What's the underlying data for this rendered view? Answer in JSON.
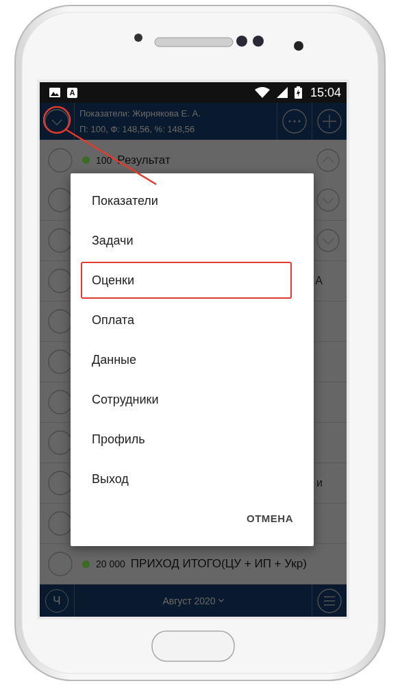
{
  "status_bar": {
    "badge": "A",
    "time": "15:04"
  },
  "header": {
    "title": "Показатели: Жирнякова Е. А.",
    "subtitle": "П: 100, Ф: 148,56, %: 148,56",
    "menu_button": {
      "highlighted": true
    }
  },
  "rows": [
    {
      "value": "100",
      "label": "Результат",
      "color": "#3b6b24",
      "expand_button": {
        "expanded": true
      }
    },
    {
      "expand_button": {
        "expanded": false
      }
    },
    {
      "expand_button": {
        "expanded": false
      }
    },
    {
      "tail": "А"
    },
    {},
    {},
    {},
    {},
    {
      "tail": "и"
    },
    {},
    {
      "value": "20 000",
      "label": "ПРИХОД ИТОГО(ЦУ + ИП + Укр)",
      "color": "#3b6b24"
    }
  ],
  "bottom_bar": {
    "left_button": "Ч",
    "period": "Август 2020"
  },
  "dialog": {
    "items": [
      {
        "label": "Показатели",
        "selected": false
      },
      {
        "label": "Задачи",
        "selected": false
      },
      {
        "label": "Оценки",
        "selected": true
      },
      {
        "label": "Оплата",
        "selected": false
      },
      {
        "label": "Данные",
        "selected": false
      },
      {
        "label": "Сотрудники",
        "selected": false
      },
      {
        "label": "Профиль",
        "selected": false
      },
      {
        "label": "Выход",
        "selected": false
      }
    ],
    "cancel": "ОТМЕНА"
  }
}
